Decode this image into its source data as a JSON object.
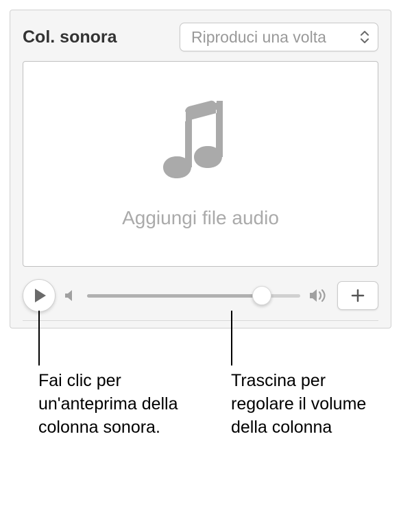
{
  "header": {
    "title": "Col. sonora",
    "dropdown_selected": "Riproduci una volta"
  },
  "drop_area": {
    "text": "Aggiungi file audio"
  },
  "controls": {
    "volume_percent": 82
  },
  "callouts": {
    "play": "Fai clic per un'anteprima della colonna sonora.",
    "volume": "Trascina per regolare il volume della colonna"
  }
}
